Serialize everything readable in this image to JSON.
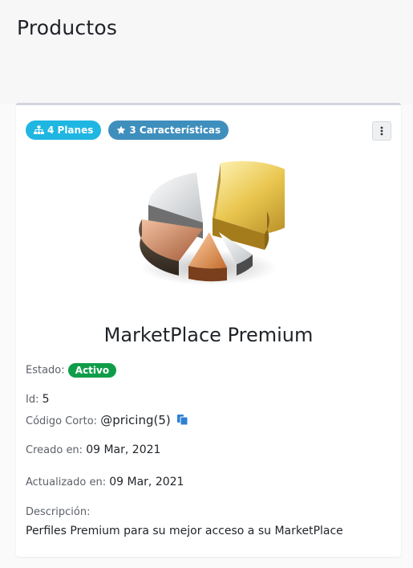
{
  "page": {
    "title": "Productos"
  },
  "card": {
    "badges": {
      "plans_label": "4 Planes",
      "features_label": "3 Características"
    },
    "product_name": "MarketPlace Premium",
    "status": {
      "label": "Estado:",
      "value": "Activo"
    },
    "id": {
      "label": "Id:",
      "value": "5"
    },
    "short_code": {
      "label": "Código Corto:",
      "value": "@pricing(5)"
    },
    "created": {
      "label": "Creado en:",
      "value": "09 Mar, 2021"
    },
    "updated": {
      "label": "Actualizado en:",
      "value": "09 Mar, 2021"
    },
    "description": {
      "label": "Descripción:",
      "value": "Perfiles Premium para su mejor acceso a su MarketPlace"
    }
  },
  "icons": {
    "plans_badge": "sitemap-icon",
    "features_badge": "star-icon",
    "menu": "vertical-ellipsis-icon",
    "copy": "copy-icon",
    "product_image": "pie-chart-image"
  },
  "colors": {
    "plans_badge": "#1fb6e2",
    "features_badge": "#3f8fbd",
    "status_active": "#0f9d4a",
    "copy_icon": "#2f7fd3"
  }
}
